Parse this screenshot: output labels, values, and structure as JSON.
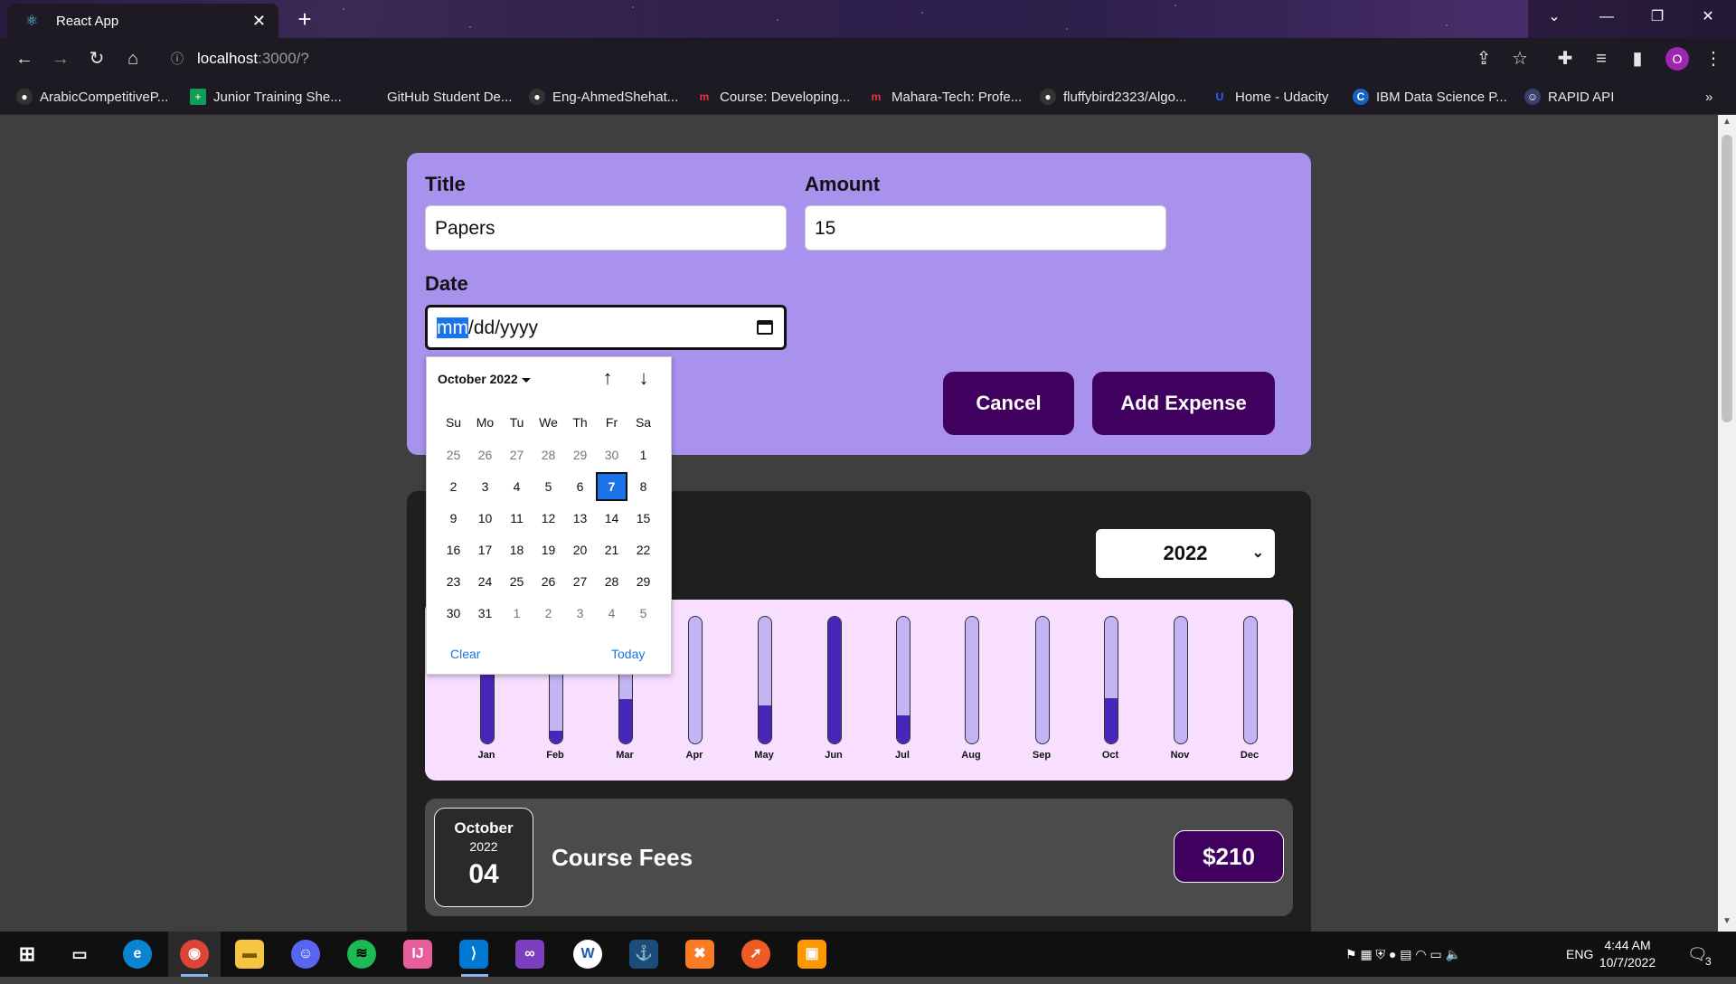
{
  "browser": {
    "tab_title": "React App",
    "url_host": "localhost",
    "url_path": ":3000/?",
    "profile_initial": "O",
    "bookmarks": [
      "ArabicCompetitiveP...",
      "Junior Training She...",
      "GitHub Student De...",
      "Eng-AhmedShehat...",
      "Course: Developing...",
      "Mahara-Tech: Profe...",
      "fluffybird2323/Algo...",
      "Home - Udacity",
      "IBM Data Science P...",
      "RAPID API"
    ],
    "bookmarks_more": "»"
  },
  "form": {
    "title_label": "Title",
    "title_value": "Papers",
    "amount_label": "Amount",
    "amount_value": "15",
    "date_label": "Date",
    "date_mm": "mm",
    "date_rest": "/dd/yyyy",
    "cancel_label": "Cancel",
    "submit_label": "Add Expense"
  },
  "datepicker": {
    "month_label": "October 2022",
    "weekdays": [
      "Su",
      "Mo",
      "Tu",
      "We",
      "Th",
      "Fr",
      "Sa"
    ],
    "weeks": [
      [
        "25",
        "26",
        "27",
        "28",
        "29",
        "30",
        "1"
      ],
      [
        "2",
        "3",
        "4",
        "5",
        "6",
        "7",
        "8"
      ],
      [
        "9",
        "10",
        "11",
        "12",
        "13",
        "14",
        "15"
      ],
      [
        "16",
        "17",
        "18",
        "19",
        "20",
        "21",
        "22"
      ],
      [
        "23",
        "24",
        "25",
        "26",
        "27",
        "28",
        "29"
      ],
      [
        "30",
        "31",
        "1",
        "2",
        "3",
        "4",
        "5"
      ]
    ],
    "selected_day": "7",
    "clear_label": "Clear",
    "today_label": "Today"
  },
  "filter": {
    "selected_year": "2022"
  },
  "chart_data": {
    "type": "bar",
    "categories": [
      "Jan",
      "Feb",
      "Mar",
      "Apr",
      "May",
      "Jun",
      "Jul",
      "Aug",
      "Sep",
      "Oct",
      "Nov",
      "Dec"
    ],
    "values": [
      1.0,
      0.1,
      0.35,
      0.0,
      0.3,
      1.0,
      0.22,
      0.0,
      0.0,
      0.36,
      0.0,
      0.0
    ],
    "ylim": [
      0,
      1
    ],
    "colors": {
      "fill": "#4826b9",
      "track": "#c3b4f3",
      "background": "#f8dfff"
    }
  },
  "expenses": [
    {
      "month": "October",
      "year": "2022",
      "day": "04",
      "title": "Course Fees",
      "amount": "$210"
    }
  ],
  "taskbar": {
    "language": "ENG",
    "time": "4:44 AM",
    "date": "10/7/2022",
    "notification_count": "3"
  },
  "colors": {
    "form_bg": "#a892ee",
    "button_bg": "#40005d",
    "panel_bg": "#1f1f1f",
    "page_bg": "#3f3f3f",
    "accent_blue": "#1a73e8"
  }
}
